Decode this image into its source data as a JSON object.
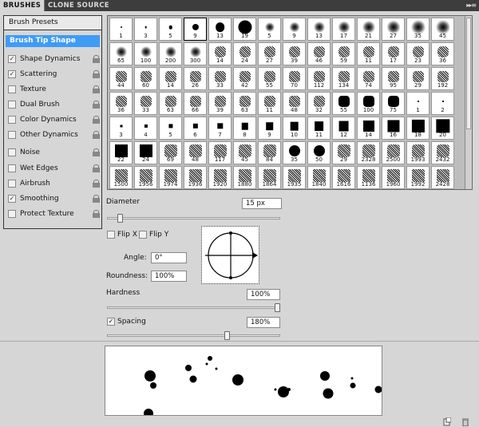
{
  "tabs": {
    "brushes": "BRUSHES",
    "clone_source": "CLONE SOURCE"
  },
  "panel_menu_icon": "double-arrow-menu-icon",
  "left": {
    "presets_label": "Brush Presets",
    "tip_shape_label": "Brush Tip Shape",
    "options": [
      {
        "label": "Shape Dynamics",
        "checked": true,
        "locked": true
      },
      {
        "label": "Scattering",
        "checked": true,
        "locked": true
      },
      {
        "label": "Texture",
        "checked": false,
        "locked": true
      },
      {
        "label": "Dual Brush",
        "checked": false,
        "locked": true
      },
      {
        "label": "Color Dynamics",
        "checked": false,
        "locked": true
      },
      {
        "label": "Other Dynamics",
        "checked": false,
        "locked": true
      },
      {
        "label": "Noise",
        "checked": false,
        "locked": true
      },
      {
        "label": "Wet Edges",
        "checked": false,
        "locked": true
      },
      {
        "label": "Airbrush",
        "checked": false,
        "locked": true
      },
      {
        "label": "Smoothing",
        "checked": true,
        "locked": true
      },
      {
        "label": "Protect Texture",
        "checked": false,
        "locked": true
      }
    ]
  },
  "brush_sizes": [
    "1",
    "3",
    "5",
    "9",
    "13",
    "19",
    "5",
    "9",
    "13",
    "17",
    "21",
    "27",
    "35",
    "45",
    "65",
    "100",
    "200",
    "300",
    "14",
    "24",
    "27",
    "39",
    "46",
    "59",
    "11",
    "17",
    "23",
    "36",
    "44",
    "60",
    "14",
    "26",
    "33",
    "42",
    "55",
    "70",
    "112",
    "134",
    "74",
    "95",
    "29",
    "192",
    "36",
    "33",
    "63",
    "66",
    "39",
    "63",
    "11",
    "48",
    "32",
    "55",
    "100",
    "75",
    "1",
    "2",
    "3",
    "4",
    "5",
    "6",
    "7",
    "8",
    "9",
    "10",
    "11",
    "12",
    "14",
    "16",
    "18",
    "20",
    "22",
    "24",
    "69",
    "48",
    "117",
    "45",
    "84",
    "35",
    "50",
    "29",
    "2328",
    "2500",
    "1993",
    "2432",
    "1500",
    "1956",
    "1974",
    "1936",
    "1920",
    "1880",
    "1864",
    "1935",
    "1840",
    "1616",
    "1136",
    "1960",
    "1992",
    "2428"
  ],
  "selected_brush_index": 3,
  "settings": {
    "diameter_label": "Diameter",
    "diameter_value": "15 px",
    "diameter_fraction": 0.06,
    "flip_x_label": "Flip X",
    "flip_y_label": "Flip Y",
    "flip_x_checked": false,
    "flip_y_checked": false,
    "angle_label": "Angle:",
    "angle_value": "0°",
    "roundness_label": "Roundness:",
    "roundness_value": "100%",
    "hardness_label": "Hardness",
    "hardness_value": "100%",
    "hardness_fraction": 1.0,
    "spacing_label": "Spacing",
    "spacing_checked": true,
    "spacing_value": "180%",
    "spacing_fraction": 0.7
  },
  "bottom_icons": [
    "new-preset-icon",
    "delete-icon"
  ]
}
